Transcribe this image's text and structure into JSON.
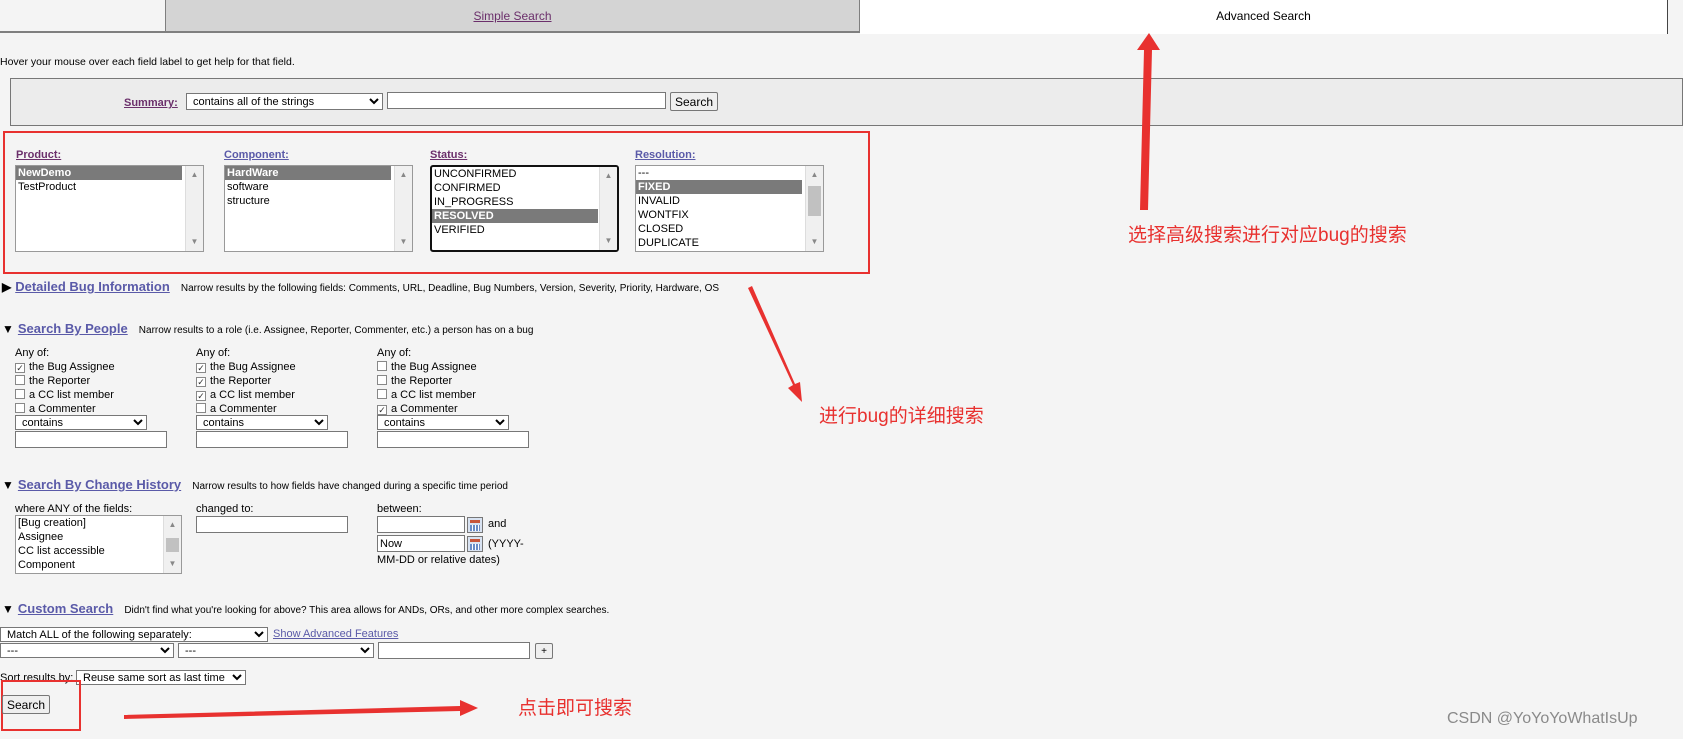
{
  "tabs": {
    "simple": "Simple Search",
    "advanced": "Advanced Search"
  },
  "hover_hint": "Hover your mouse over each field label to get help for that field.",
  "summary": {
    "label": "Summary:",
    "operator": "contains all of the strings",
    "value": "",
    "button": "Search"
  },
  "product": {
    "label": "Product:",
    "options": [
      "NewDemo",
      "TestProduct"
    ],
    "selected": "NewDemo"
  },
  "component": {
    "label": "Component:",
    "options": [
      "HardWare",
      "software",
      "structure"
    ],
    "selected": "HardWare"
  },
  "status": {
    "label": "Status:",
    "options": [
      "UNCONFIRMED",
      "CONFIRMED",
      "IN_PROGRESS",
      "RESOLVED",
      "VERIFIED"
    ],
    "selected": "RESOLVED"
  },
  "resolution": {
    "label": "Resolution:",
    "options": [
      "---",
      "FIXED",
      "INVALID",
      "WONTFIX",
      "CLOSED",
      "DUPLICATE"
    ],
    "selected": "FIXED"
  },
  "detailed": {
    "title": "Detailed Bug Information",
    "desc": "Narrow results by the following fields: Comments, URL, Deadline, Bug Numbers, Version, Severity, Priority, Hardware, OS"
  },
  "people": {
    "title": "Search By People",
    "desc": "Narrow results to a role (i.e. Assignee, Reporter, Commenter, etc.) a person has on a bug",
    "any_of": "Any of:",
    "roles": [
      "the Bug Assignee",
      "the Reporter",
      "a CC list member",
      "a Commenter"
    ],
    "groups": [
      {
        "checked": [
          true,
          false,
          false,
          false
        ],
        "operator": "contains",
        "value": ""
      },
      {
        "checked": [
          true,
          true,
          true,
          false
        ],
        "operator": "contains",
        "value": ""
      },
      {
        "checked": [
          false,
          false,
          false,
          true
        ],
        "operator": "contains",
        "value": ""
      }
    ]
  },
  "history": {
    "title": "Search By Change History",
    "desc": "Narrow results to how fields have changed during a specific time period",
    "fields_label": "where ANY of the fields:",
    "fields": [
      "[Bug creation]",
      "Assignee",
      "CC list accessible",
      "Component"
    ],
    "changed_label": "changed to:",
    "between_label": "between:",
    "from": "",
    "to": "Now",
    "and": "and",
    "date_hint_1": "(YYYY-",
    "date_hint_2": "MM-DD or relative dates)"
  },
  "custom": {
    "title": "Custom Search",
    "desc": "Didn't find what you're looking for above? This area allows for ANDs, ORs, and other more complex searches.",
    "match": "Match ALL of the following separately:",
    "advanced_link": "Show Advanced Features",
    "field": "---",
    "op": "---",
    "value": "",
    "add": "+"
  },
  "sort": {
    "label": "Sort results by:",
    "value": "Reuse same sort as last time"
  },
  "search_button": "Search",
  "annotations": {
    "advanced": "选择高级搜索进行对应bug的搜索",
    "detail": "进行bug的详细搜索",
    "click": "点击即可搜索"
  },
  "watermark": "CSDN @YoYoYoWhatIsUp"
}
